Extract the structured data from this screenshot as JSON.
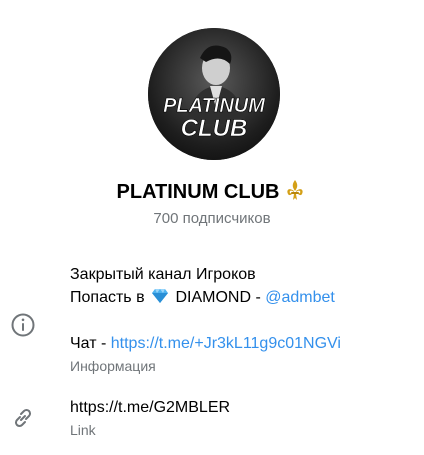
{
  "channel": {
    "name": "PLATINUM CLUB",
    "title_emoji": "fleur-de-lis",
    "subscribers": "700 подписчиков",
    "avatar_text_line1": "PLATINUM",
    "avatar_text_line2": "CLUB"
  },
  "info": {
    "line1": "Закрытый канал Игроков",
    "line2_prefix": "Попасть в",
    "line2_emoji": "gem-diamond",
    "line2_mid": "DIAMOND -",
    "line2_mention": "@admbet",
    "chat_prefix": "Чат -",
    "chat_link": "https://t.me/+Jr3kL11g9c01NGVi",
    "caption": "Информация"
  },
  "link_row": {
    "url": "https://t.me/G2MBLER",
    "caption": "Link"
  },
  "colors": {
    "accent": "#3390ec",
    "secondary_text": "#707579",
    "icon_gray": "#707579"
  },
  "icons": [
    "info-icon",
    "link-icon"
  ]
}
